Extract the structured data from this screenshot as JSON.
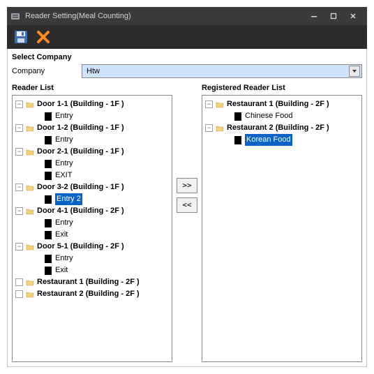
{
  "window": {
    "title": "Reader Setting(Meal Counting)"
  },
  "select_company": {
    "heading": "Select Company",
    "label": "Company",
    "value": "Htw"
  },
  "left_panel": {
    "heading": "Reader List",
    "nodes": [
      {
        "type": "parent",
        "label": "Door 1-1 (Building - 1F )"
      },
      {
        "type": "child",
        "label": "Entry"
      },
      {
        "type": "parent",
        "label": "Door 1-2 (Building - 1F )"
      },
      {
        "type": "child",
        "label": "Entry"
      },
      {
        "type": "parent",
        "label": "Door 2-1 (Building - 1F )"
      },
      {
        "type": "child",
        "label": "Entry"
      },
      {
        "type": "child",
        "label": "EXIT"
      },
      {
        "type": "parent",
        "label": "Door 3-2 (Building - 1F )"
      },
      {
        "type": "child",
        "label": "Entry 2",
        "selected": true
      },
      {
        "type": "parent",
        "label": "Door 4-1 (Building - 2F )"
      },
      {
        "type": "child",
        "label": "Entry"
      },
      {
        "type": "child",
        "label": "Exit"
      },
      {
        "type": "parent",
        "label": "Door 5-1 (Building - 2F )"
      },
      {
        "type": "child",
        "label": "Entry"
      },
      {
        "type": "child",
        "label": "Exit"
      },
      {
        "type": "leafparent",
        "label": "Restaurant 1 (Building - 2F )"
      },
      {
        "type": "leafparent",
        "label": "Restaurant 2 (Building - 2F )"
      }
    ]
  },
  "right_panel": {
    "heading": "Registered Reader List",
    "nodes": [
      {
        "type": "parent",
        "label": "Restaurant 1 (Building - 2F )"
      },
      {
        "type": "child",
        "label": "Chinese Food"
      },
      {
        "type": "parent",
        "label": "Restaurant 2 (Building - 2F )"
      },
      {
        "type": "child",
        "label": "Korean Food",
        "selected": true
      }
    ]
  },
  "buttons": {
    "move_right": ">>",
    "move_left": "<<"
  }
}
